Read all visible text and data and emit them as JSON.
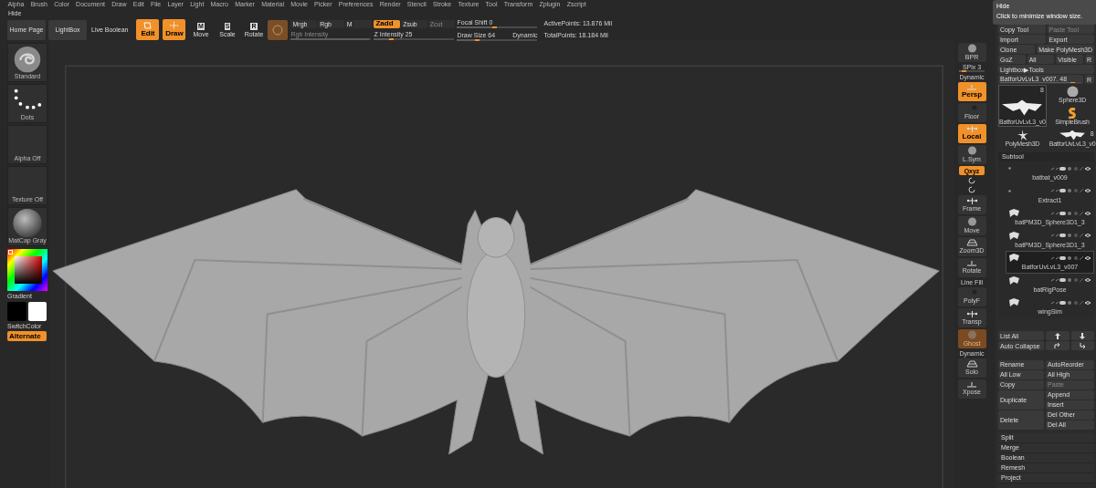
{
  "menu": [
    "Alpha",
    "Brush",
    "Color",
    "Document",
    "Draw",
    "Edit",
    "File",
    "Layer",
    "Light",
    "Macro",
    "Marker",
    "Material",
    "Movie",
    "Picker",
    "Preferences",
    "Render",
    "Stencil",
    "Stroke",
    "Texture",
    "Tool",
    "Transform",
    "Zplugin",
    "Zscript"
  ],
  "hide": "Hide",
  "toolbar": {
    "buttons": [
      "Home Page",
      "LightBox"
    ],
    "live_boolean": {
      "label": "Live Boolean",
      "on": false
    },
    "modes": [
      {
        "label": "Edit",
        "selected": true
      },
      {
        "label": "Draw",
        "selected": true
      },
      {
        "label": "Move",
        "key": "M",
        "selected": false
      },
      {
        "label": "Scale",
        "key": "S",
        "selected": false
      },
      {
        "label": "Rotate",
        "key": "R",
        "selected": false
      }
    ],
    "color_modes": [
      {
        "label": "Mrgb",
        "selected": false
      },
      {
        "label": "Rgb",
        "selected": false
      },
      {
        "label": "M",
        "selected": false
      }
    ],
    "rgb_intensity": {
      "label": "Rgb Intensity",
      "disabled": true,
      "level": 0.97
    },
    "z_modes": [
      {
        "label": "Zadd",
        "selected": true,
        "disabled": false
      },
      {
        "label": "Zsub",
        "selected": false,
        "disabled": false
      },
      {
        "label": "Zcut",
        "selected": false,
        "disabled": true
      }
    ],
    "z_intensity": {
      "label": "Z Intensity 25",
      "level": 0.25
    },
    "focal_shift": {
      "label": "Focal Shift 0",
      "level": 0.5
    },
    "draw_size": {
      "label": "Draw Size 64",
      "level": 0.28,
      "dynamic": "Dynamic"
    },
    "stats": [
      "ActivePoints: 13.876 Mil",
      "TotalPoints: 18.184 Mil"
    ]
  },
  "left": {
    "tiles": [
      {
        "label": "Standard",
        "kind": "brush"
      },
      {
        "label": "Dots",
        "kind": "stroke"
      },
      {
        "label": "Alpha Off",
        "kind": "empty"
      },
      {
        "label": "Texture Off",
        "kind": "empty"
      },
      {
        "label": "MatCap Gray",
        "kind": "material"
      }
    ],
    "gradient": "Gradient",
    "swatches": [
      {
        "color": "#000000"
      },
      {
        "color": "#ffffff"
      }
    ],
    "switch_color": "SwitchColor",
    "alternate": {
      "label": "Alternate",
      "on": true
    }
  },
  "shelf": [
    {
      "label": "BPR",
      "kind": "button",
      "selected": false,
      "disabled": false
    },
    {
      "label": "SPix 3",
      "kind": "slider",
      "level": 0.3
    },
    {
      "label": "Persp",
      "kind": "button",
      "top": "Dynamic",
      "selected": true,
      "disabled": false
    },
    {
      "label": "Floor",
      "kind": "button",
      "selected": false,
      "disabled": false
    },
    {
      "label": "Local",
      "kind": "button",
      "selected": true,
      "disabled": false
    },
    {
      "label": "L.Sym",
      "kind": "button",
      "selected": false,
      "disabled": false
    },
    {
      "label": "Qxyz",
      "kind": "small",
      "selected": true,
      "disabled": false
    },
    {
      "kind": "icon"
    },
    {
      "kind": "icon"
    },
    {
      "label": "Frame",
      "kind": "button",
      "selected": false,
      "disabled": false
    },
    {
      "label": "Move",
      "kind": "button",
      "selected": false,
      "disabled": false
    },
    {
      "label": "Zoom3D",
      "kind": "button",
      "selected": false,
      "disabled": false
    },
    {
      "label": "Rotate",
      "kind": "button",
      "selected": false,
      "disabled": false
    },
    {
      "label": "PolyF",
      "kind": "button",
      "top": "Line Fill",
      "selected": false,
      "disabled": false
    },
    {
      "label": "Transp",
      "kind": "button",
      "selected": false,
      "disabled": false
    },
    {
      "label": "Ghost",
      "kind": "button",
      "selected": true,
      "disabled": true
    },
    {
      "label": "Solo",
      "kind": "button",
      "top": "Dynamic",
      "selected": false,
      "disabled": false
    },
    {
      "label": "Xpose",
      "kind": "button",
      "selected": false,
      "disabled": false
    }
  ],
  "tooltip": {
    "title": "Hide",
    "text": "Click to minimize window size."
  },
  "tool": {
    "rows": [
      [
        {
          "label": "Copy Tool",
          "disabled": false
        },
        {
          "label": "Paste Tool",
          "disabled": true
        }
      ],
      [
        {
          "label": "Import",
          "disabled": false
        },
        {
          "label": "Export",
          "disabled": false
        }
      ],
      [
        {
          "label": "Clone",
          "disabled": false
        },
        {
          "label": "Make PolyMesh3D",
          "disabled": false
        }
      ],
      [
        {
          "label": "GoZ",
          "disabled": false
        },
        {
          "label": "All",
          "disabled": false
        },
        {
          "label": "Visible",
          "disabled": false
        },
        {
          "label": "R",
          "disabled": false
        }
      ]
    ],
    "lightbox": "Lightbox▶Tools",
    "current": {
      "label": "BatforUvLvL3_v007. 48",
      "level": 0.92,
      "reset": "R"
    },
    "thumbnails": [
      {
        "label": "BatforUvLvL3_v0",
        "count": "8",
        "kind": "bat",
        "selected": true
      },
      {
        "label": "Sphere3D",
        "kind": "sphere",
        "selected": false
      },
      {
        "label": "SimpleBrush",
        "kind": "brush",
        "selected": false
      },
      {
        "label": "PolyMesh3D",
        "kind": "star",
        "selected": false
      },
      {
        "label": "BatforUvLvL3_v0",
        "count": "8",
        "kind": "bat",
        "selected": false
      }
    ]
  },
  "subtool": {
    "title": "Subtool",
    "items": [
      {
        "name": "batbat_v009",
        "thumbnail": false,
        "selected": false
      },
      {
        "name": "Extract1",
        "thumbnail": false,
        "selected": false
      },
      {
        "name": "batPM3D_Sphere3D1_3",
        "thumbnail": true,
        "selected": false
      },
      {
        "name": "batPM3D_Sphere3D1_3",
        "thumbnail": true,
        "selected": false
      },
      {
        "name": "BatforUvLvL3_v007",
        "thumbnail": true,
        "selected": true
      },
      {
        "name": "batRigPose",
        "thumbnail": true,
        "selected": false
      },
      {
        "name": "wingSim",
        "thumbnail": true,
        "selected": false
      }
    ],
    "list_all": "List All",
    "auto_collapse": "Auto Collapse",
    "actions": [
      {
        "left": {
          "label": "Rename",
          "disabled": false
        },
        "right": [
          {
            "label": "AutoReorder",
            "disabled": false
          }
        ]
      },
      {
        "left": {
          "label": "All Low",
          "disabled": false
        },
        "right": [
          {
            "label": "All High",
            "disabled": false
          }
        ]
      },
      {
        "left": {
          "label": "Copy",
          "disabled": false
        },
        "right": [
          {
            "label": "Paste",
            "disabled": true
          }
        ]
      },
      {
        "left": {
          "label": "Duplicate",
          "disabled": false
        },
        "right": [
          {
            "label": "Append",
            "disabled": false
          },
          {
            "label": "Insert",
            "disabled": false
          }
        ]
      },
      {
        "left": {
          "label": "Delete",
          "disabled": false
        },
        "right": [
          {
            "label": "Del Other",
            "disabled": false
          },
          {
            "label": "Del All",
            "disabled": false
          }
        ]
      }
    ],
    "sections": [
      "Split",
      "Merge",
      "Boolean",
      "Remesh",
      "Project"
    ]
  }
}
